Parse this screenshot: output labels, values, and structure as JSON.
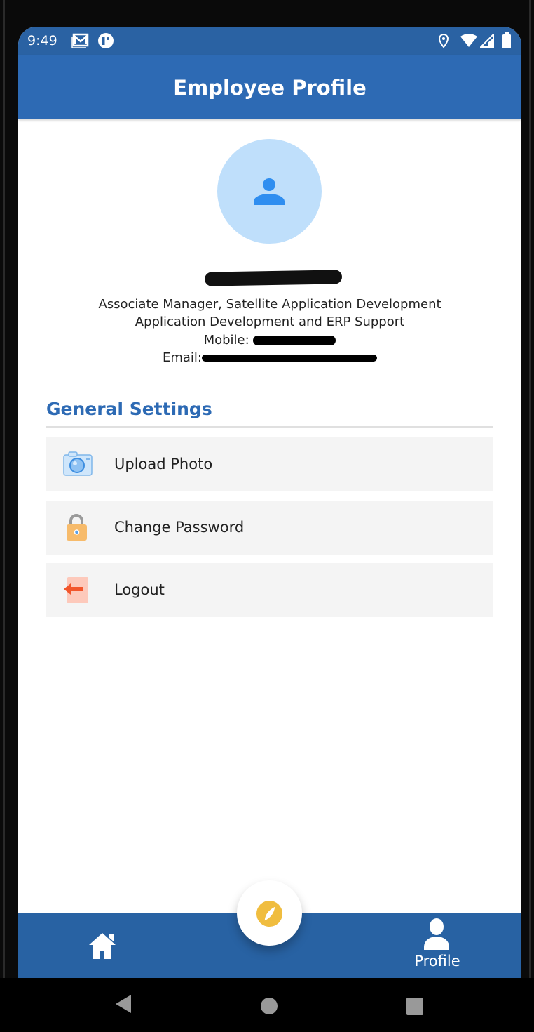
{
  "status_bar": {
    "time": "9:49",
    "icons": [
      "gmail-icon",
      "app-notification-icon",
      "location-icon",
      "wifi-icon",
      "signal-icon",
      "battery-icon"
    ]
  },
  "header": {
    "title": "Employee Profile"
  },
  "profile": {
    "designation": "Associate Manager, Satellite Application Development",
    "department": "Application Development and ERP Support",
    "mobile_label": "Mobile:",
    "email_label": "Email:"
  },
  "settings": {
    "title": "General Settings",
    "items": [
      {
        "label": "Upload Photo",
        "icon": "camera-icon"
      },
      {
        "label": "Change Password",
        "icon": "lock-icon"
      },
      {
        "label": "Logout",
        "icon": "logout-icon"
      }
    ]
  },
  "bottom_nav": {
    "home_icon": "home-icon",
    "center_icon": "compass-icon",
    "profile_label": "Profile"
  },
  "colors": {
    "primary": "#2d6ab4",
    "accent": "#f0bd3f",
    "item_bg": "#f4f4f4"
  }
}
